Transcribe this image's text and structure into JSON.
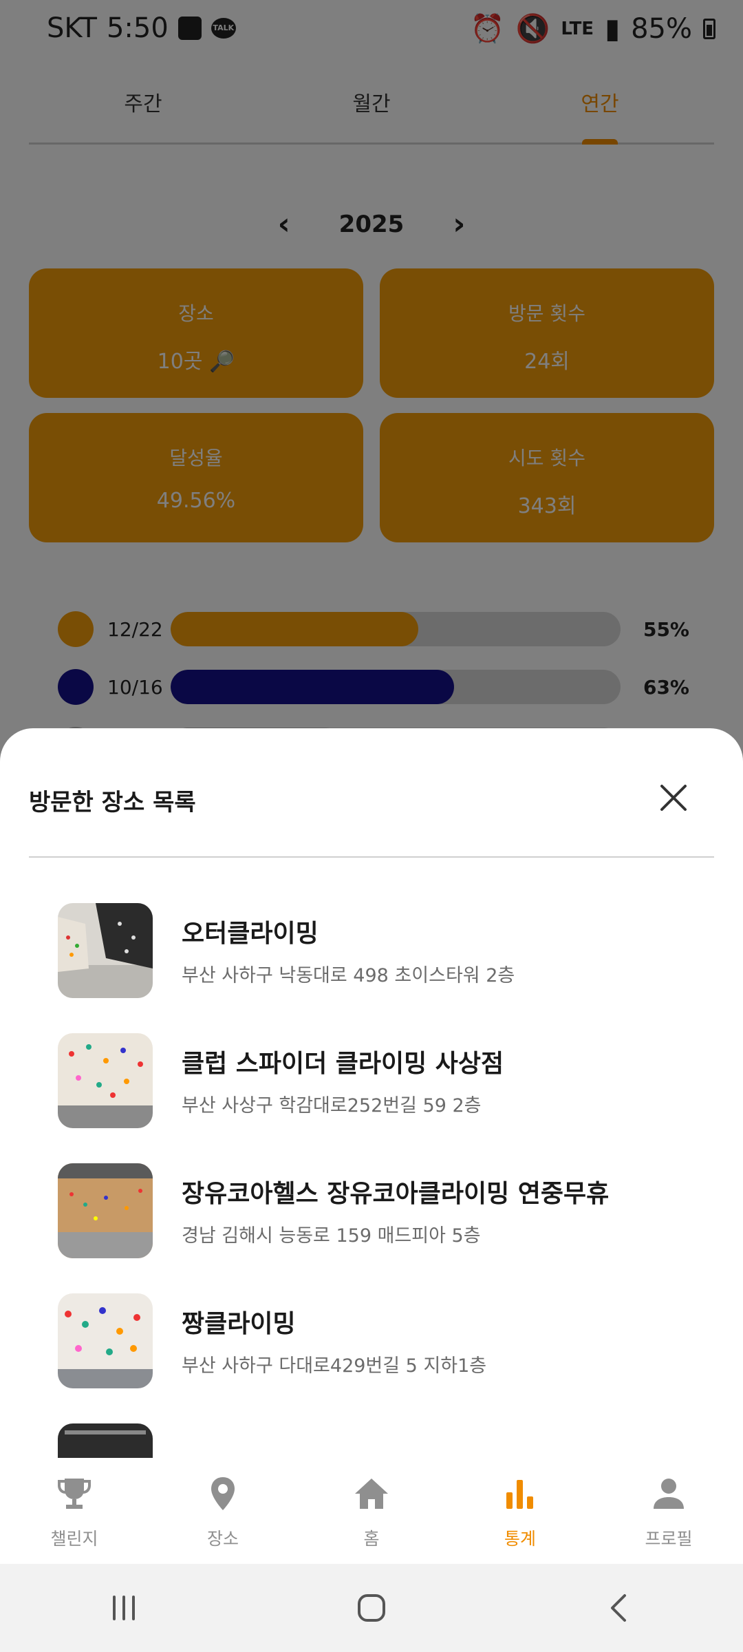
{
  "status_bar": {
    "carrier": "SKT",
    "time": "5:50",
    "talk_badge": "TALK",
    "network": "LTE",
    "battery": "85%"
  },
  "tabs": [
    {
      "label": "주간",
      "active": false
    },
    {
      "label": "월간",
      "active": false
    },
    {
      "label": "연간",
      "active": true
    }
  ],
  "year_nav": {
    "year": "2025",
    "prev_icon": "chevron-left-icon",
    "next_icon": "chevron-right-icon"
  },
  "stats": [
    {
      "label": "장소",
      "value": "10곳 🔎"
    },
    {
      "label": "방문 횟수",
      "value": "24회"
    },
    {
      "label": "달성율",
      "value": "49.56%"
    },
    {
      "label": "시도 횟수",
      "value": "343회"
    }
  ],
  "progress_rows": [
    {
      "color": "#f39c0b",
      "ratio": "12/22",
      "percent": "55%",
      "fill": 0.55
    },
    {
      "color": "#15108a",
      "ratio": "10/16",
      "percent": "63%",
      "fill": 0.63
    },
    {
      "color": "#bbbbbb",
      "ratio": "",
      "percent": "",
      "fill": 0.38
    }
  ],
  "sheet": {
    "title": "방문한 장소 목록",
    "close_icon": "close-icon",
    "places": [
      {
        "name": "오터클라이밍",
        "address": "부산 사하구 낙동대로 498 초이스타워 2층"
      },
      {
        "name": "클럽 스파이더 클라이밍 사상점",
        "address": "부산 사상구 학감대로252번길 59 2층"
      },
      {
        "name": "장유코아헬스 장유코아클라이밍 연중무휴",
        "address": "경남 김해시 능동로 159 매드피아 5층"
      },
      {
        "name": "짱클라이밍",
        "address": "부산 사하구 다대로429번길 5 지하1층"
      },
      {
        "name": "",
        "address": ""
      }
    ]
  },
  "bottom_nav": [
    {
      "label": "챌린지",
      "icon": "trophy-icon",
      "active": false
    },
    {
      "label": "장소",
      "icon": "location-pin-icon",
      "active": false
    },
    {
      "label": "홈",
      "icon": "home-icon",
      "active": false
    },
    {
      "label": "통계",
      "icon": "bar-chart-icon",
      "active": true
    },
    {
      "label": "프로필",
      "icon": "person-icon",
      "active": false
    }
  ],
  "colors": {
    "accent": "#f08c00",
    "card": "#f39c0b",
    "navy": "#15108a",
    "inactive": "#8f8f8f"
  }
}
